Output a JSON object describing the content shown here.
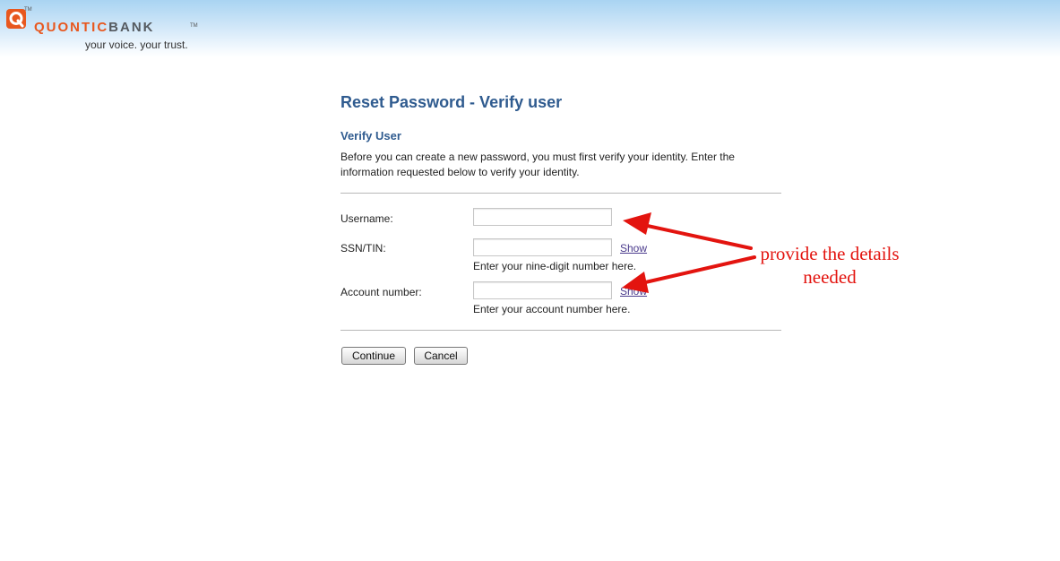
{
  "brand": {
    "logo_quontic": "QUONTIC",
    "logo_bank": "BANK",
    "logo_mark": "Q",
    "trademark": "TM",
    "tagline": "your voice. your trust.",
    "orange": "#e8571e",
    "gray": "#555a60"
  },
  "page": {
    "title": "Reset Password - Verify user",
    "section_title": "Verify User",
    "intro": "Before you can create a new password, you must first verify your identity. Enter the information requested below to verify your identity.",
    "title_color": "#2f5b8f"
  },
  "form": {
    "username": {
      "label": "Username:",
      "value": ""
    },
    "ssn": {
      "label": "SSN/TIN:",
      "value": "",
      "show_label": "Show",
      "hint": "Enter your nine-digit number here."
    },
    "account": {
      "label": "Account number:",
      "value": "",
      "show_label": "Show",
      "hint": "Enter your account number here."
    },
    "continue_label": "Continue",
    "cancel_label": "Cancel"
  },
  "annotation": {
    "text": "provide the details needed",
    "color": "#e3140f"
  }
}
